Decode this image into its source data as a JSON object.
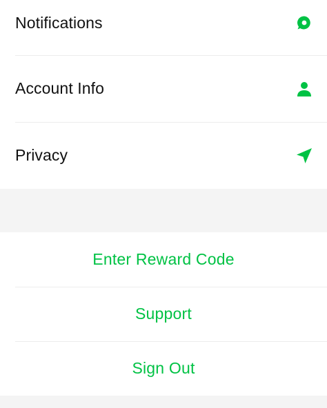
{
  "colors": {
    "accent": "#00C244",
    "text": "#111111",
    "divider": "#ECECEC",
    "band": "#F4F4F4"
  },
  "settings": {
    "items": [
      {
        "label": "Notifications",
        "icon": "chat-bubble-icon"
      },
      {
        "label": "Account Info",
        "icon": "person-icon"
      },
      {
        "label": "Privacy",
        "icon": "location-arrow-icon"
      }
    ]
  },
  "actions": {
    "items": [
      {
        "label": "Enter Reward Code"
      },
      {
        "label": "Support"
      },
      {
        "label": "Sign Out"
      }
    ]
  }
}
